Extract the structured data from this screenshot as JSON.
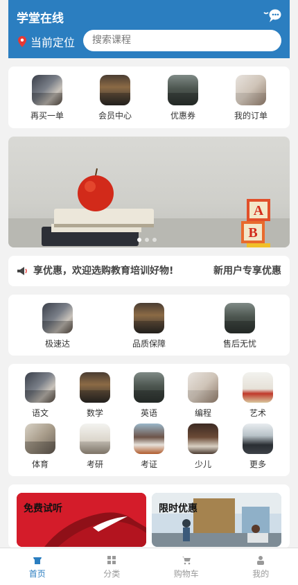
{
  "header": {
    "title": "学堂在线",
    "message_icon": "chat-bubble-icon",
    "location_icon": "map-pin-icon",
    "location_label": "当前定位",
    "search_placeholder": "搜索课程",
    "color": "#2b7ec0"
  },
  "quick_menu": [
    {
      "label": "再买一单",
      "icon": "typing-laptop-photo"
    },
    {
      "label": "会员中心",
      "icon": "library-photo"
    },
    {
      "label": "优惠券",
      "icon": "classroom-photo"
    },
    {
      "label": "我的订单",
      "icon": "writing-photo"
    }
  ],
  "banner": {
    "image": "apple-on-books-photo",
    "slides": 3,
    "active_slide": 1
  },
  "notice": {
    "icon": "megaphone-icon",
    "text": "享优惠，欢迎选购教育培训好物!",
    "tag": "新用户专享优惠"
  },
  "services": [
    {
      "label": "极速达",
      "icon": "typing-laptop-photo"
    },
    {
      "label": "品质保障",
      "icon": "library-photo"
    },
    {
      "label": "售后无忧",
      "icon": "classroom-photo"
    }
  ],
  "categories": [
    {
      "label": "语文",
      "icon": "typing-laptop-photo"
    },
    {
      "label": "数学",
      "icon": "library-photo"
    },
    {
      "label": "英语",
      "icon": "classroom-photo"
    },
    {
      "label": "编程",
      "icon": "writing-photo"
    },
    {
      "label": "艺术",
      "icon": "desk-apple-photo"
    },
    {
      "label": "体育",
      "icon": "kids-playing-photo"
    },
    {
      "label": "考研",
      "icon": "lecture-photo"
    },
    {
      "label": "考证",
      "icon": "student-smiling-photo"
    },
    {
      "label": "少儿",
      "icon": "study-desk-photo"
    },
    {
      "label": "更多",
      "icon": "graduation-photo"
    }
  ],
  "promos": [
    {
      "title": "免费试听",
      "image": "red-sneaker-photo"
    },
    {
      "title": "限时优惠",
      "image": "open-office-photo"
    }
  ],
  "tabbar": [
    {
      "label": "首页",
      "icon": "home-icon",
      "active": true
    },
    {
      "label": "分类",
      "icon": "grid-icon",
      "active": false
    },
    {
      "label": "购物车",
      "icon": "cart-icon",
      "active": false
    },
    {
      "label": "我的",
      "icon": "user-icon",
      "active": false
    }
  ]
}
